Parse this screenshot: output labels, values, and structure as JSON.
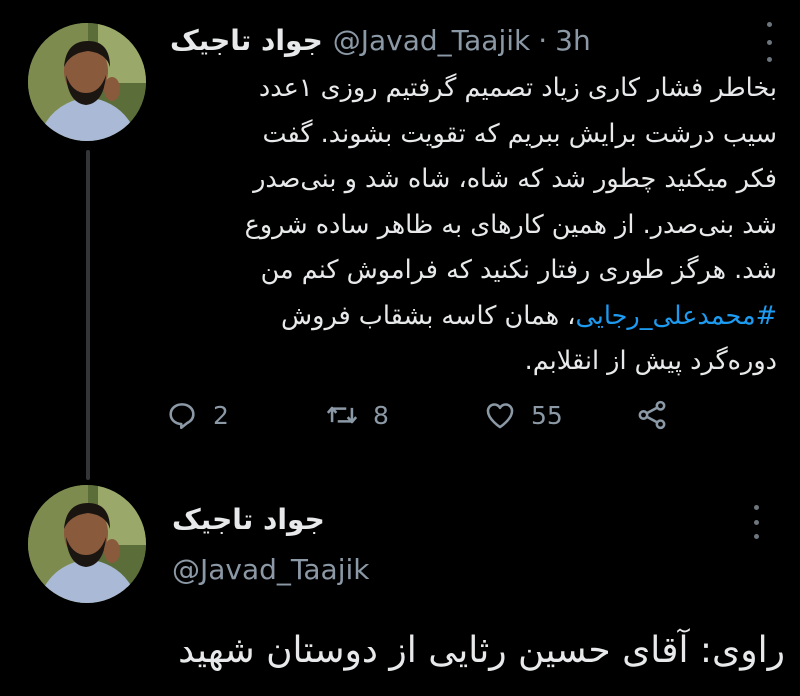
{
  "tweet1": {
    "author_name": "جواد تاجیک",
    "handle": "@Javad_Taajik",
    "separator": "·",
    "time": "3h",
    "avatar_icon": "avatar-photo",
    "text_lines": [
      "بخاطر فشار کاری زیاد تصمیم گرفتیم روزی ۱عدد",
      "سیب درشت برایش ببریم که تقویت بشوند. گفت",
      "فکر میکنید چطور شد که شاه، شاه شد و بنی‌صدر",
      "شد بنی‌صدر. از همین کارهای به ظاهر ساده شروع",
      "شد. هرگز طوری رفتار نکنید که فراموش کنم من"
    ],
    "hashtag": "#محمدعلی_رجایی",
    "hashtag_suffix": "، همان کاسه بشقاب فروش",
    "last_line": "دوره‌گرد پیش از انقلابم.",
    "hashtag_color": "#1d9bf0",
    "actions": {
      "reply_icon": "reply-icon",
      "reply_count": "2",
      "retweet_icon": "retweet-icon",
      "retweet_count": "8",
      "like_icon": "heart-icon",
      "like_count": "55",
      "share_icon": "share-icon"
    }
  },
  "tweet2": {
    "author_name": "جواد تاجیک",
    "handle": "@Javad_Taajik",
    "text": "راوی: آقای حسین رثایی از دوستان شهید"
  },
  "colors": {
    "background": "#000000",
    "text": "#e7e9ea",
    "muted": "#8b98a5",
    "thread_line": "#333639"
  }
}
